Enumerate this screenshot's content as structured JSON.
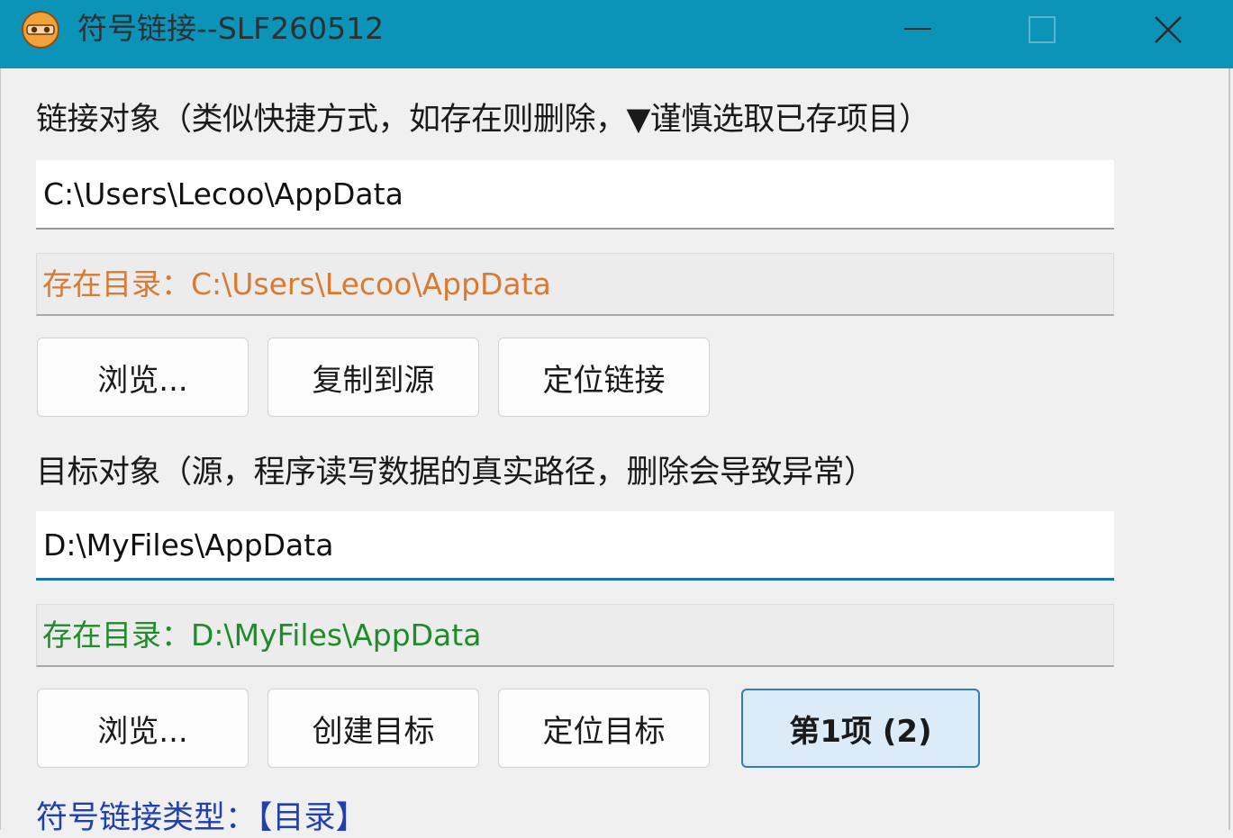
{
  "window": {
    "title": "符号链接--SLF260512"
  },
  "link_section": {
    "label": "链接对象（类似快捷方式，如存在则删除，▼谨慎选取已存项目）",
    "path_value": "C:\\Users\\Lecoo\\AppData",
    "status": "存在目录：C:\\Users\\Lecoo\\AppData",
    "status_color": "#d97a32",
    "buttons": {
      "browse": "浏览...",
      "copy_to_source": "复制到源",
      "locate_link": "定位链接"
    }
  },
  "target_section": {
    "label": "目标对象（源，程序读写数据的真实路径，删除会导致异常）",
    "path_value": "D:\\MyFiles\\AppData",
    "status": "存在目录：D:\\MyFiles\\AppData",
    "status_color": "#1e8c28",
    "buttons": {
      "browse": "浏览...",
      "create_target": "创建目标",
      "locate_target": "定位目标",
      "item_selector": "第1项 (2)"
    }
  },
  "link_type": "符号链接类型：【目录】",
  "colors": {
    "titlebar": "#0b94b8",
    "accent": "#2f7cc0",
    "link_type_text": "#1f3fb2"
  },
  "icons": {
    "app": "app-logo-icon",
    "minimize": "minimize-icon",
    "maximize": "maximize-icon",
    "close": "close-icon"
  }
}
